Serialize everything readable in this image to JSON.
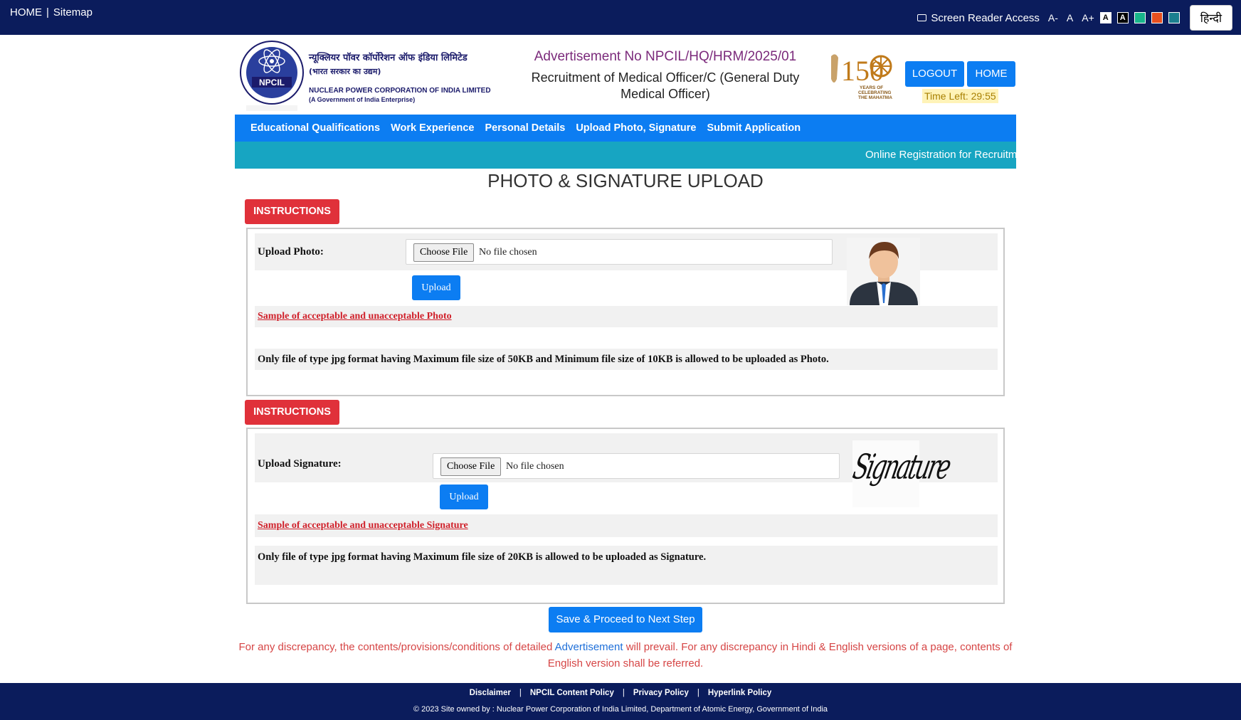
{
  "topbar": {
    "home": "HOME",
    "sitemap": "Sitemap",
    "screen_reader": "Screen Reader Access",
    "font_small": "A-",
    "font_normal": "A",
    "font_large": "A+",
    "theme_a1": "A",
    "theme_a2": "A",
    "hindi": "हिन्दी"
  },
  "header": {
    "org_hindi": "न्यूक्लियर पॉवर कॉर्पोरेशन ऑफ इंडिया लिमिटेड",
    "org_hindi_sub": "(भारत सरकार का उद्यम)",
    "org_english": "NUCLEAR POWER CORPORATION OF INDIA LIMITED",
    "org_english_sub": "(A Government of India Enterprise)",
    "advertisement": "Advertisement No NPCIL/HQ/HRM/2025/01",
    "recruitment": "Recruitment of Medical Officer/C (General Duty Medical Officer)",
    "logout": "LOGOUT",
    "home": "HOME",
    "time_left": "Time Left: 29:55"
  },
  "nav": [
    "Educational Qualifications",
    "Work Experience",
    "Personal Details",
    "Upload Photo, Signature",
    "Submit Application"
  ],
  "marquee": "Online Registration for Recruitm",
  "page_title": "PHOTO & SIGNATURE UPLOAD",
  "photo_section": {
    "instructions": "INSTRUCTIONS",
    "label": "Upload Photo:",
    "choose": "Choose File",
    "nofile": "No file chosen",
    "upload": "Upload",
    "sample_link": "Sample of acceptable and unacceptable Photo",
    "note": "Only file of type jpg format having Maximum file size of 50KB and Minimum file size of 10KB is allowed to be uploaded as Photo."
  },
  "signature_section": {
    "instructions": "INSTRUCTIONS",
    "label": "Upload Signature:",
    "choose": "Choose File",
    "nofile": "No file chosen",
    "upload": "Upload",
    "sample_link": "Sample of acceptable and unacceptable Signature",
    "note": "Only file of type jpg format having Maximum file size of 20KB is allowed to be uploaded as Signature.",
    "sample_text": "Signature"
  },
  "save_button": "Save & Proceed to Next Step",
  "disclaimer": {
    "part1": "For any discrepancy, the contents/provisions/conditions of detailed ",
    "link": "Advertisement",
    "part2": " will prevail. For any discrepancy in Hindi & English versions of a page, contents of English version shall be referred."
  },
  "footer": {
    "links": [
      "Disclaimer",
      "NPCIL Content Policy",
      "Privacy Policy",
      "Hyperlink Policy"
    ],
    "copyright": "© 2023 Site owned by : Nuclear Power Corporation of India Limited, Department of Atomic Energy, Government of India"
  },
  "emblem": {
    "npcil": "NPCIL",
    "years": "150",
    "caption1": "YEARS OF",
    "caption2": "CELEBRATING",
    "caption3": "THE MAHATMA"
  }
}
